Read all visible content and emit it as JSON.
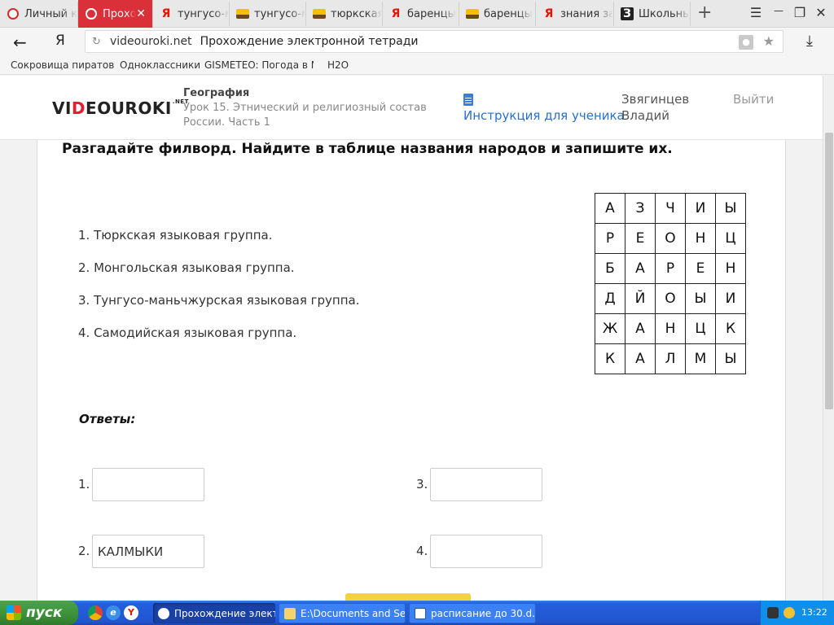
{
  "browser": {
    "tabs": [
      {
        "label": "Личный к",
        "icon": "dr-icon",
        "active": false
      },
      {
        "label": "Прохожд",
        "icon": "dr-icon",
        "active": true
      },
      {
        "label": "тунгусо-м",
        "icon": "yandex-icon",
        "active": false
      },
      {
        "label": "тунгусо-м",
        "icon": "image-icon",
        "active": false
      },
      {
        "label": "тюркская",
        "icon": "image-icon",
        "active": false
      },
      {
        "label": "баренцы",
        "icon": "yandex-icon",
        "active": false
      },
      {
        "label": "баренцы",
        "icon": "image-icon",
        "active": false
      },
      {
        "label": "знания за",
        "icon": "yandex-icon",
        "active": false
      },
      {
        "label": "Школьны",
        "icon": "school-icon",
        "active": false
      }
    ],
    "close_glyph": "✕",
    "add_tab_glyph": "+",
    "menu_glyph": "☰",
    "minimize_glyph": "—",
    "restore_glyph": "❐",
    "close_window_glyph": "✕",
    "back_glyph": "←",
    "yandex_glyph": "Я",
    "reload_glyph": "↻",
    "domain": "videouroki.net",
    "page_title": "Прохождение электронной тетради",
    "lock_glyph": "🔒",
    "star_glyph": "★",
    "download_glyph": "⤓",
    "bookmarks": [
      "Сокровища пиратов",
      "Одноклассники",
      "GISMETEO: Погода в М",
      "H2O"
    ]
  },
  "site": {
    "logo_prefix": "VI",
    "logo_accent": "D",
    "logo_suffix": "EOUROKI",
    "logo_sup": ".NET",
    "subject": "География",
    "lesson": "Урок 15. Этнический и религиозный состав России. Часть 1",
    "instructions": "Инструкция для ученика",
    "user_first": "Звягинцев",
    "user_second": "Владий",
    "logout": "Выйти"
  },
  "task": {
    "title": "Разгадайте филворд. Найдите в таблице названия народов и запишите их.",
    "questions": [
      "1. Тюркская языковая группа.",
      "2. Монгольская языковая группа.",
      "3. Тунгусо-маньчжурская языковая группа.",
      "4. Самодийская языковая группа."
    ],
    "grid": [
      [
        "А",
        "З",
        "Ч",
        "И",
        "Ы"
      ],
      [
        "Р",
        "Е",
        "О",
        "Н",
        "Ц"
      ],
      [
        "Б",
        "А",
        "Р",
        "Е",
        "Н"
      ],
      [
        "Д",
        "Й",
        "О",
        "Ы",
        "И"
      ],
      [
        "Ж",
        "А",
        "Н",
        "Ц",
        "К"
      ],
      [
        "К",
        "А",
        "Л",
        "М",
        "Ы"
      ]
    ],
    "answers_label": "Ответы:",
    "answers": [
      {
        "label": "1.",
        "value": ""
      },
      {
        "label": "2.",
        "value": "КАЛМЫКИ"
      },
      {
        "label": "3.",
        "value": ""
      },
      {
        "label": "4.",
        "value": ""
      }
    ]
  },
  "taskbar": {
    "start_label": "пуск",
    "buttons": [
      {
        "label": "Прохождение элект...",
        "active": true
      },
      {
        "label": "E:\\Documents and Se...",
        "active": false
      },
      {
        "label": "расписание до 30.d...",
        "active": false
      }
    ],
    "clock": "13:22"
  },
  "colors": {
    "accent": "#d9303a",
    "link": "#2a6fc9",
    "taskbar": "#245edb",
    "start": "#3c8f3a"
  }
}
